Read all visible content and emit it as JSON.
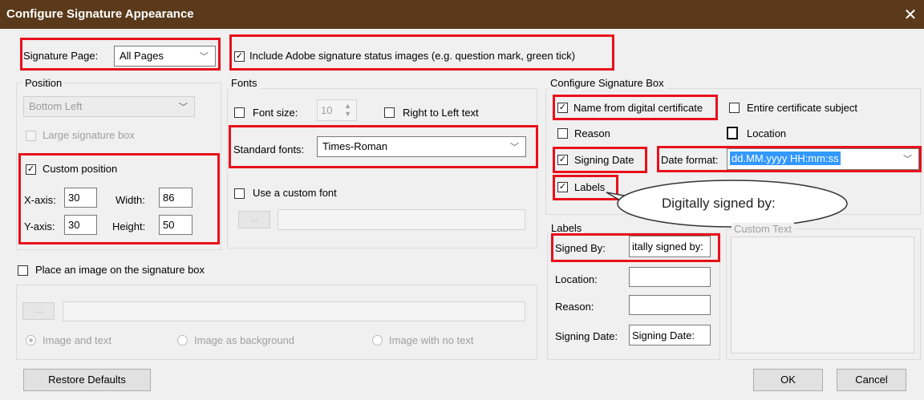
{
  "window": {
    "title": "Configure Signature Appearance",
    "close_glyph": "✕"
  },
  "signature_page": {
    "label": "Signature Page:",
    "value": "All Pages"
  },
  "include_status": {
    "label": "Include Adobe signature status images (e.g. question mark, green tick)",
    "checked": true
  },
  "position": {
    "group_label": "Position",
    "preset_value": "Bottom Left",
    "large_box_label": "Large signature box",
    "custom_position_label": "Custom position",
    "x_label": "X-axis:",
    "x_value": "30",
    "width_label": "Width:",
    "width_value": "86",
    "y_label": "Y-axis:",
    "y_value": "30",
    "height_label": "Height:",
    "height_value": "50"
  },
  "fonts": {
    "group_label": "Fonts",
    "font_size_label": "Font size:",
    "font_size_value": "10",
    "rtl_label": "Right to Left text",
    "standard_label": "Standard fonts:",
    "standard_value": "Times-Roman",
    "custom_font_label": "Use a custom font",
    "browse_label": "..."
  },
  "image": {
    "place_label": "Place an image on the signature box",
    "browse_label": "...",
    "radio_text": "Image and text",
    "radio_background": "Image as background",
    "radio_no_text": "Image with no text"
  },
  "sigbox": {
    "group_label": "Configure Signature Box",
    "name_cert_label": "Name from digital certificate",
    "entire_subject_label": "Entire certificate subject",
    "reason_label": "Reason",
    "location_label": "Location",
    "signing_date_label": "Signing Date",
    "date_format_label": "Date format:",
    "date_format_value": "dd.MM.yyyy HH:mm:ss",
    "labels_label": "Labels"
  },
  "callout": {
    "text": "Digitally signed by:"
  },
  "labels": {
    "group_label": "Labels",
    "signed_by_label": "Signed By:",
    "signed_by_value": "itally signed by:",
    "location_label": "Location:",
    "location_value": "",
    "reason_label": "Reason:",
    "reason_value": "",
    "signing_date_label": "Signing Date:",
    "signing_date_value": "Signing Date:"
  },
  "custom_text": {
    "group_label": "Custom Text"
  },
  "buttons": {
    "restore": "Restore Defaults",
    "ok": "OK",
    "cancel": "Cancel"
  },
  "colors": {
    "highlight": "#e8101b",
    "titlebar": "#5a3a1a",
    "selection": "#3399ff"
  }
}
